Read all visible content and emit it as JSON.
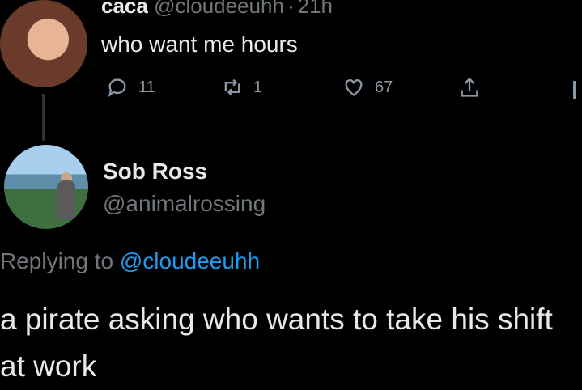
{
  "tweet": {
    "name": "caca",
    "handle": "@cloudeeuhh",
    "separator": "·",
    "time": "21h",
    "text": "who want me hours",
    "actions": {
      "reply_count": "11",
      "retweet_count": "1",
      "like_count": "67"
    }
  },
  "reply": {
    "name": "Sob Ross",
    "handle": "@animalrossing",
    "replying_prefix": "Replying to",
    "replying_handle": "@cloudeeuhh",
    "text": "a pirate asking who wants to take his shift at work"
  },
  "colors": {
    "background": "#000000",
    "text": "#e7e9ea",
    "muted": "#71767b",
    "link": "#1d9bf0"
  },
  "icons": [
    "reply-icon",
    "retweet-icon",
    "like-icon",
    "share-icon",
    "more-icon"
  ]
}
